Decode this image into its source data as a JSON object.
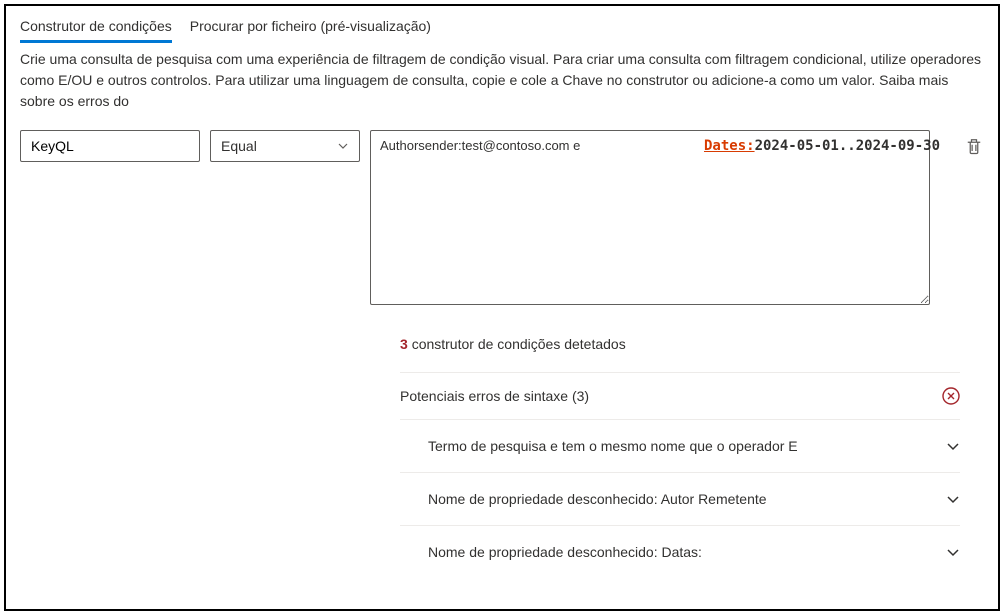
{
  "tabs": {
    "builder": "Construtor de condições",
    "file_search": "Procurar por ficheiro (pré-visualização)"
  },
  "description": "Crie uma consulta de pesquisa com uma experiência de filtragem de condição visual. Para criar uma consulta com filtragem condicional, utilize operadores como E/OU e outros controlos. Para utilizar uma linguagem de consulta, copie e cole a Chave no construtor ou adicione-a como um valor. Saiba mais sobre os erros do",
  "builder": {
    "field_value": "KeyQL",
    "operator_value": "Equal",
    "query_left": "Authorsender:test@contoso.com e",
    "query_dates_label": "Dates:",
    "query_dates_value": "2024-05-01..2024-09-30"
  },
  "results": {
    "count": "3",
    "count_label": "construtor de condições detetados",
    "syntax_header": "Potenciais erros de sintaxe (3)",
    "errors": [
      "Termo de pesquisa e tem o mesmo nome que o operador E",
      "Nome de propriedade desconhecido: Autor Remetente",
      "Nome de propriedade desconhecido: Datas:"
    ]
  }
}
